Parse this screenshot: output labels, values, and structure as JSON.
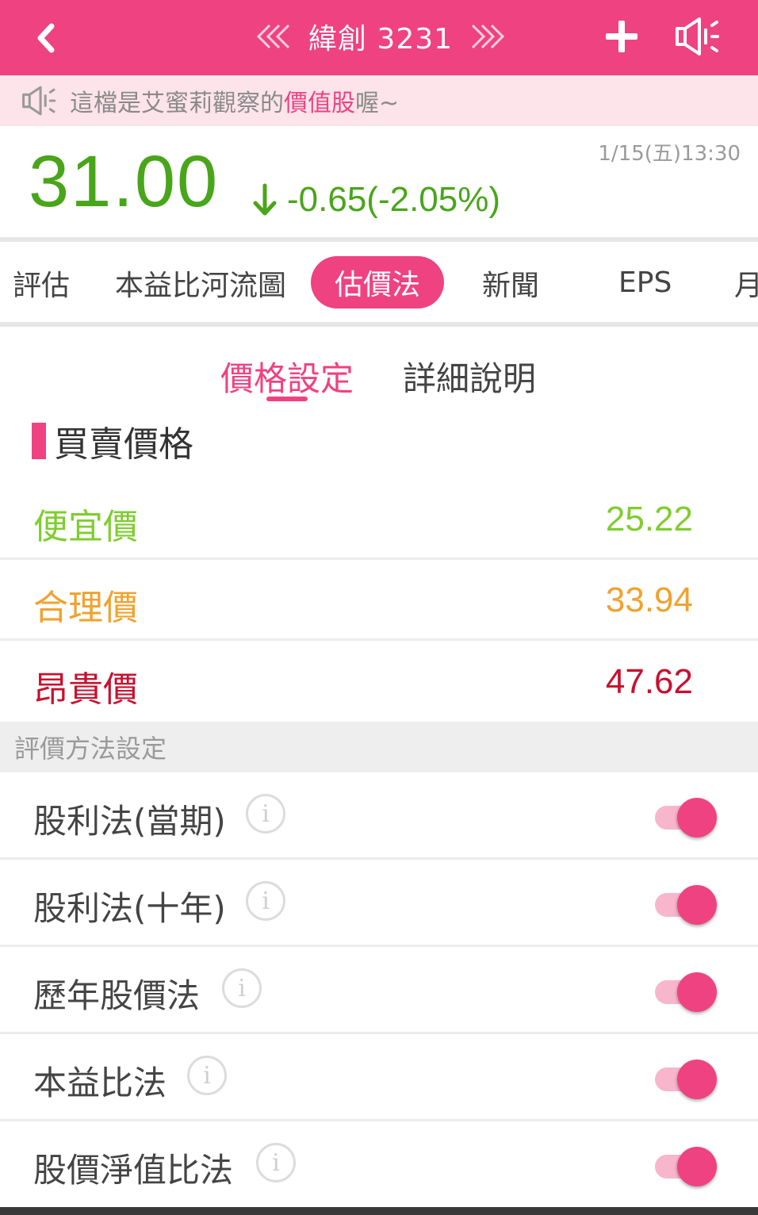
{
  "header": {
    "title": "緯創 3231",
    "colors": {
      "brand": "#ef4281"
    }
  },
  "notice": {
    "prefix": "這檔是艾蜜莉觀察的",
    "highlight": "價值股",
    "suffix": "喔~"
  },
  "quote": {
    "price": "31.00",
    "change": "-0.65(-2.05%)",
    "timestamp": "1/15(五)13:30",
    "color": "#49a51a"
  },
  "tabs": [
    {
      "label": "評估"
    },
    {
      "label": "本益比河流圖"
    },
    {
      "label": "估價法",
      "active": true
    },
    {
      "label": "新聞"
    },
    {
      "label": "EPS"
    },
    {
      "label": "月"
    }
  ],
  "subtabs": [
    {
      "label": "價格設定",
      "active": true
    },
    {
      "label": "詳細說明"
    }
  ],
  "section_title": "買賣價格",
  "prices": [
    {
      "label": "便宜價",
      "value": "25.22",
      "color": "#7fcd2f"
    },
    {
      "label": "合理價",
      "value": "33.94",
      "color": "#f0a22e"
    },
    {
      "label": "昂貴價",
      "value": "47.62",
      "color": "#c8102e"
    }
  ],
  "method_header": "評價方法設定",
  "methods": [
    {
      "label": "股利法(當期)",
      "enabled": true
    },
    {
      "label": "股利法(十年)",
      "enabled": true
    },
    {
      "label": "歷年股價法",
      "enabled": true
    },
    {
      "label": "本益比法",
      "enabled": true
    },
    {
      "label": "股價淨值比法",
      "enabled": true
    }
  ],
  "info_glyph": "i"
}
